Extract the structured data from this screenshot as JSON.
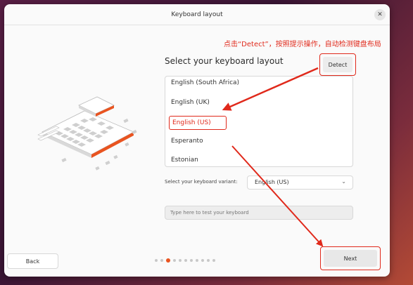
{
  "window": {
    "title": "Keyboard layout"
  },
  "annotation": {
    "text": "点击“Detect”，按照提示操作，自动检测键盘布局"
  },
  "main": {
    "heading": "Select your keyboard layout",
    "detect_label": "Detect",
    "layouts": [
      "English (South Africa)",
      "English (UK)",
      "English (US)",
      "Esperanto",
      "Estonian"
    ],
    "selected_index": 2,
    "variant_label": "Select your keyboard variant:",
    "variant_value": "English (US)",
    "test_placeholder": "Type here to test your keyboard"
  },
  "footer": {
    "back_label": "Back",
    "next_label": "Next",
    "progress": {
      "total_steps": 11,
      "current_step": 3
    }
  },
  "colors": {
    "accent": "#e95420",
    "annotation": "#e0291b"
  },
  "icons": {
    "close": "close-icon",
    "chevron": "chevron-down-icon"
  }
}
